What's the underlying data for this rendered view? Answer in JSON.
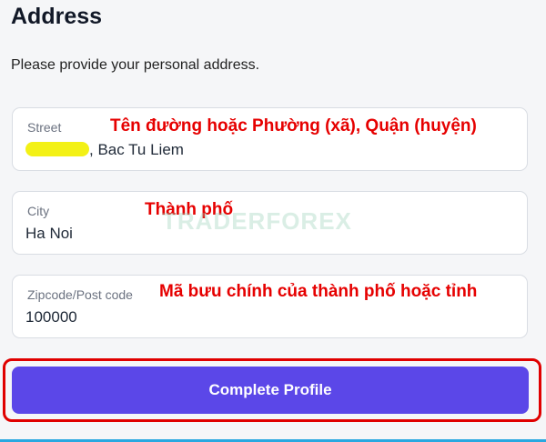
{
  "title": "Address",
  "subtitle": "Please provide your personal address.",
  "fields": {
    "street": {
      "label": "Street",
      "value": ", Bac Tu Liem",
      "annotation": "Tên đường hoặc Phường (xã), Quận (huyện)"
    },
    "city": {
      "label": "City",
      "value": "Ha Noi",
      "annotation": "Thành phố"
    },
    "zip": {
      "label": "Zipcode/Post code",
      "value": "100000",
      "annotation": "Mã bưu chính của thành phố hoặc tỉnh"
    }
  },
  "button_label": "Complete Profile",
  "watermark": "TRADERFOREX",
  "colors": {
    "primary_button": "#5b47e8",
    "annotation": "#e60000",
    "highlight_border": "#e00000",
    "redaction": "#f3f116"
  }
}
